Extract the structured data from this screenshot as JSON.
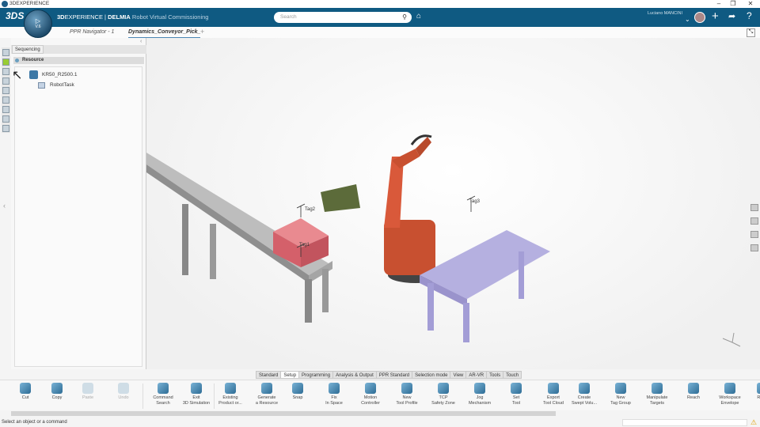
{
  "window": {
    "title": "3DEXPERIENCE",
    "controls": [
      "–",
      "❐",
      "✕"
    ]
  },
  "header": {
    "brand_bold": "3D",
    "brand_rest": "EXPERIENCE | ",
    "brand_app": "DELMIA",
    "brand_sub": " Robot Virtual Commissioning",
    "compass_version": "V.6",
    "compass_3d": "3D",
    "search_placeholder": "Search",
    "user_name": "Luciano MANCINI",
    "accent": "#0f5a82"
  },
  "tabs": [
    {
      "label": "PPR Navigator - 1",
      "active": false
    },
    {
      "label": "Dynamics_Conveyor_Pick_",
      "active": true
    }
  ],
  "add_tab": "+",
  "panel": {
    "tab": "Sequencing",
    "section": "Resource",
    "tree": [
      {
        "label": "KR50_R2500.1"
      },
      {
        "label": "RobotTask"
      }
    ]
  },
  "scene": {
    "tags": [
      "Tag1",
      "Tag2",
      "Tag3"
    ]
  },
  "toolbar_tabs": [
    "Standard",
    "Setup",
    "Programming",
    "Analysis & Output",
    "PPR Standard",
    "Selection mode",
    "View",
    "AR-VR",
    "Tools",
    "Touch"
  ],
  "active_toolbar_tab": "Setup",
  "tools": [
    {
      "l1": "Cut",
      "l2": "",
      "disabled": false
    },
    {
      "l1": "Copy",
      "l2": "",
      "disabled": false
    },
    {
      "l1": "Paste",
      "l2": "",
      "disabled": true
    },
    {
      "l1": "Undo",
      "l2": "",
      "disabled": true
    },
    {
      "l1": "Command",
      "l2": "Search",
      "disabled": false
    },
    {
      "l1": "Exit",
      "l2": "3D Simulation",
      "disabled": false
    },
    {
      "l1": "Existing",
      "l2": "Product or...",
      "disabled": false
    },
    {
      "l1": "Generate",
      "l2": "a Resource",
      "disabled": false
    },
    {
      "l1": "Snap",
      "l2": "",
      "disabled": false
    },
    {
      "l1": "Fix",
      "l2": "In Space",
      "disabled": false
    },
    {
      "l1": "Motion",
      "l2": "Controller",
      "disabled": false
    },
    {
      "l1": "New",
      "l2": "Tool Profile",
      "disabled": false
    },
    {
      "l1": "TCP",
      "l2": "Safety Zone",
      "disabled": false
    },
    {
      "l1": "Jog",
      "l2": "Mechanism",
      "disabled": false
    },
    {
      "l1": "Set",
      "l2": "Tool",
      "disabled": false
    },
    {
      "l1": "Export",
      "l2": "Tool Cloud",
      "disabled": false
    },
    {
      "l1": "Create",
      "l2": "Swept Volu...",
      "disabled": false
    },
    {
      "l1": "New",
      "l2": "Tag Group",
      "disabled": false
    },
    {
      "l1": "Manipulate",
      "l2": "Targets",
      "disabled": false
    },
    {
      "l1": "Reach",
      "l2": "",
      "disabled": false
    },
    {
      "l1": "Workspace",
      "l2": "Envelope",
      "disabled": false
    },
    {
      "l1": "Repo",
      "l2": "to",
      "disabled": false
    }
  ],
  "status": {
    "message": "Select an object or a command"
  }
}
